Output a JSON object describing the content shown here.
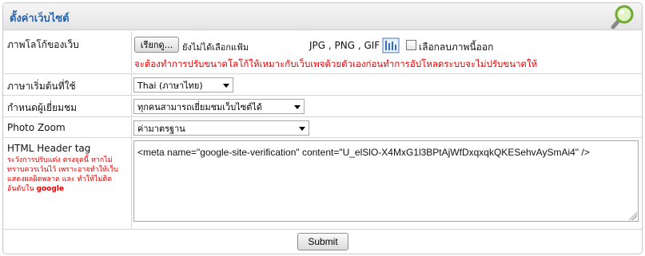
{
  "header": {
    "title": "ตั้งค่าเว็บไซต์",
    "icon": "magnifier-icon"
  },
  "logo_row": {
    "label": "ภาพโลโก้ของเว็บ",
    "browse_button": "เรียกดู...",
    "no_file_text": "ยังไม่ได้เลือกแฟ้ม",
    "formats_text": "JPG , PNG , GIF",
    "remove_checkbox_label": "เลือกลบภาพนี้ออก",
    "remove_checked": false,
    "warning": "จะต้องทำการปรับขนาดโลโก้ให้เหมาะกับเว็บเพจด้วยตัวเองก่อนทำการอัปโหลดระบบจะไม่ปรับขนาดให้"
  },
  "language_row": {
    "label": "ภาษาเริ่มต้นที่ใช้",
    "selected": "Thai (ภาษาไทย)"
  },
  "visitor_row": {
    "label": "กำหนดผู้เยี่ยมชม",
    "selected": "ทุกคนสามารถเยี่ยมชมเว็บไซต์ได้"
  },
  "zoom_row": {
    "label": "Photo Zoom",
    "selected": "ค่ามาตรฐาน"
  },
  "header_tag_row": {
    "label": "HTML Header tag",
    "note": "ระวังการปรับแต่ง ตรงจุดนี้ หากไม่ทราบควรเว้นไว้ เพราะอาจทำให้เว็บแสดงผลผิดพลาด และ ทำให้ไม่ติดอันดับใน",
    "note_bold": "google",
    "value": "<meta name=\"google-site-verification\" content=\"U_elSlO-X4MxG1l3BPtAjWfDxqxqkQKESehvAySmAi4\" />"
  },
  "submit_label": "Submit",
  "colors": {
    "title_blue": "#2a62a8",
    "warning_red": "#e60000"
  }
}
